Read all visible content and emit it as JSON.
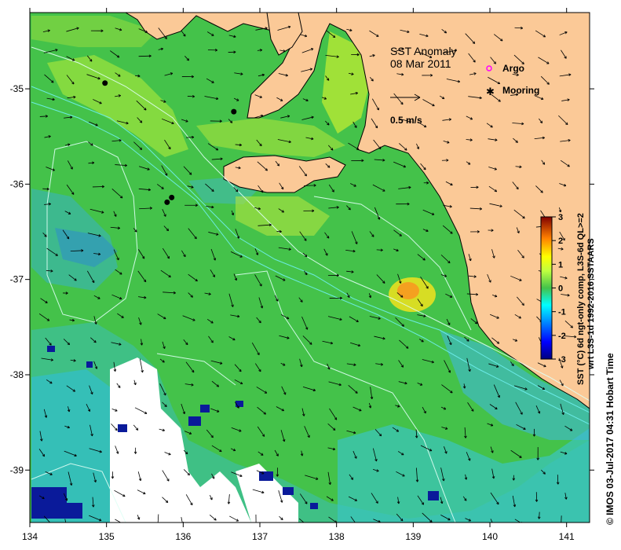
{
  "map": {
    "title": "SST Anomaly",
    "date": "08 Mar 2011",
    "x_ticks": [
      "134",
      "135",
      "136",
      "137",
      "138",
      "139",
      "140",
      "141"
    ],
    "y_ticks": [
      "-35",
      "-36",
      "-37",
      "-38",
      "-39"
    ],
    "lon_range": [
      134.0,
      141.3
    ],
    "lat_range": [
      -39.55,
      -34.2
    ]
  },
  "legend": {
    "argo_label": "Argo",
    "mooring_label": "Mooring",
    "argo_color": "#ff00ff",
    "mooring_color": "#000000"
  },
  "scale": {
    "label": "0.5 m/s"
  },
  "colorbar": {
    "ticks": [
      "3",
      "2",
      "1",
      "0",
      "-1",
      "-2",
      "-3"
    ],
    "label_line1": "SST (°C) 6d ngt-only comp, L3S-6d QL>=2",
    "label_line2": "wrt L3S-1d 1992-2016 SSTAARS",
    "colors": [
      "#00007f",
      "#0000ff",
      "#0080ff",
      "#00ffff",
      "#7fff7f",
      "#ffff00",
      "#ff8000",
      "#ff0000",
      "#7f0000"
    ]
  },
  "credit": "© IMOS 03-Jul-2017 04:31 Hobart Time",
  "moorings": [
    {
      "lon": 134.98,
      "lat": -34.94
    },
    {
      "lon": 136.66,
      "lat": -35.24
    },
    {
      "lon": 135.85,
      "lat": -36.14
    },
    {
      "lon": 135.79,
      "lat": -36.19
    }
  ],
  "colors": {
    "land": "#fbc997",
    "sea_base": "#44c24a",
    "missing": "#ffffff"
  }
}
